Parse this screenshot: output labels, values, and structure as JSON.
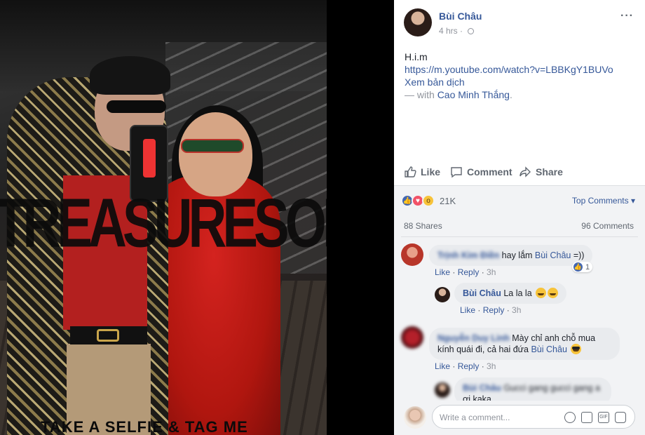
{
  "photo": {
    "watermark": "TREASURESOFFICIAL",
    "bottom_text": "TAKE A SELFIE & TAG ME",
    "phone_label": "SHOP"
  },
  "post": {
    "author": "Bùi Châu",
    "time": "4 hrs",
    "text_line1": "H.i.m",
    "url": "https://m.youtube.com/watch?v=LBBKgY1BUVo",
    "translate": "Xem bản dịch",
    "with_prefix": "— with ",
    "with_name": "Cao Minh Thắng",
    "with_suffix": "."
  },
  "actions": {
    "like": "Like",
    "comment": "Comment",
    "share": "Share"
  },
  "stats": {
    "reaction_count": "21K",
    "top_comments": "Top Comments",
    "shares": "88 Shares",
    "comments": "96 Comments"
  },
  "comments": [
    {
      "author": "Trịnh Kim Điền",
      "text": " hay lắm ",
      "mention": "Bùi Châu",
      "tail": " =))",
      "like_label": "Like",
      "reply_label": "Reply",
      "time": "3h",
      "likes": "1"
    },
    {
      "author": "Bùi Châu",
      "text": " La la la",
      "like_label": "Like",
      "reply_label": "Reply",
      "time": "3h"
    },
    {
      "author": "Nguyễn Duy Linh",
      "text": " Mày chỉ anh chỗ mua",
      "text2": "kính quái đi, cả hai đứa ",
      "mention": "Bùi Châu",
      "like_label": "Like",
      "reply_label": "Reply",
      "time": "3h"
    },
    {
      "author": "Bùi Châu",
      "text": " Gucci gang gucci gang a",
      "text2": "ơi kaka"
    }
  ],
  "composer": {
    "placeholder": "Write a comment..."
  },
  "colors": {
    "link": "#365899",
    "like_blue": "#4267b2",
    "love_red": "#f25268",
    "wow_yellow": "#f7c33a"
  }
}
